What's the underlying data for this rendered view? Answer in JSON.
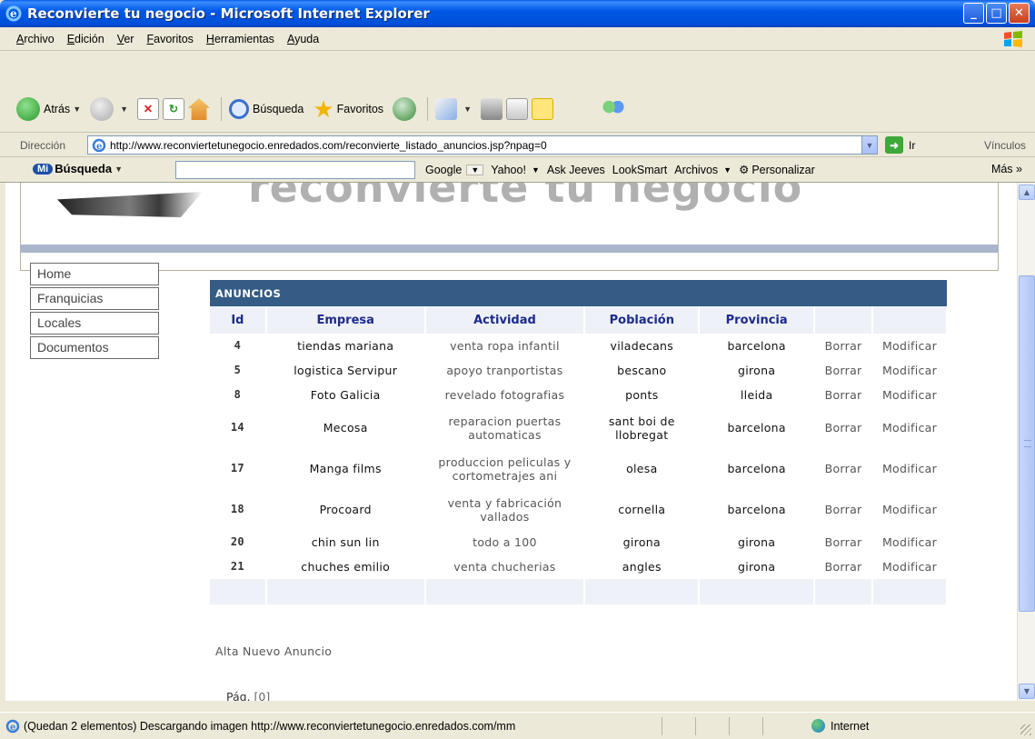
{
  "window": {
    "title": "Reconvierte tu negocio - Microsoft Internet Explorer"
  },
  "menu": [
    "Archivo",
    "Edición",
    "Ver",
    "Favoritos",
    "Herramientas",
    "Ayuda"
  ],
  "toolbar": {
    "back": "Atrás",
    "search": "Búsqueda",
    "favorites": "Favoritos"
  },
  "address": {
    "label": "Dirección",
    "url": "http://www.reconviertetunegocio.enredados.com/reconvierte_listado_anuncios.jsp?npag=0",
    "go": "Ir",
    "links": "Vínculos"
  },
  "searchbar": {
    "logo_badge": "Mi",
    "logo_text": "Búsqueda",
    "links": [
      "Google",
      "Yahoo!",
      "Ask Jeeves",
      "LookSmart",
      "Archivos"
    ],
    "customize": "Personalizar",
    "more": "Más"
  },
  "page": {
    "header_text": "reconvierte tu negocio",
    "nav": [
      "Home",
      "Franquicias",
      "Locales",
      "Documentos"
    ],
    "table_title": "ANUNCIOS",
    "columns": [
      "Id",
      "Empresa",
      "Actividad",
      "Población",
      "Provincia",
      "",
      ""
    ],
    "rows": [
      {
        "id": "4",
        "empresa": "tiendas mariana",
        "actividad": "venta ropa infantil",
        "poblacion": "viladecans",
        "provincia": "barcelona",
        "borrar": "Borrar",
        "modificar": "Modificar"
      },
      {
        "id": "5",
        "empresa": "logistica Servipur",
        "actividad": "apoyo tranportistas",
        "poblacion": "bescano",
        "provincia": "girona",
        "borrar": "Borrar",
        "modificar": "Modificar"
      },
      {
        "id": "8",
        "empresa": "Foto Galicia",
        "actividad": "revelado fotografias",
        "poblacion": "ponts",
        "provincia": "lleida",
        "borrar": "Borrar",
        "modificar": "Modificar"
      },
      {
        "id": "14",
        "empresa": "Mecosa",
        "actividad": "reparacion puertas automaticas",
        "poblacion": "sant boi de llobregat",
        "provincia": "barcelona",
        "borrar": "Borrar",
        "modificar": "Modificar"
      },
      {
        "id": "17",
        "empresa": "Manga films",
        "actividad": "produccion peliculas y cortometrajes ani",
        "poblacion": "olesa",
        "provincia": "barcelona",
        "borrar": "Borrar",
        "modificar": "Modificar"
      },
      {
        "id": "18",
        "empresa": "Procoard",
        "actividad": "venta y fabricación vallados",
        "poblacion": "cornella",
        "provincia": "barcelona",
        "borrar": "Borrar",
        "modificar": "Modificar"
      },
      {
        "id": "20",
        "empresa": "chin sun lin",
        "actividad": "todo a 100",
        "poblacion": "girona",
        "provincia": "girona",
        "borrar": "Borrar",
        "modificar": "Modificar"
      },
      {
        "id": "21",
        "empresa": "chuches emilio",
        "actividad": "venta chucherias",
        "poblacion": "angles",
        "provincia": "girona",
        "borrar": "Borrar",
        "modificar": "Modificar"
      }
    ],
    "new_link": "Alta Nuevo Anuncio",
    "pagination_label": "Pág.",
    "pagination_current": "[0]"
  },
  "status": {
    "text": "(Quedan 2 elementos) Descargando imagen http://www.reconviertetunegocio.enredados.com/mm",
    "zone": "Internet"
  },
  "colors": {
    "titlebar": "#0058e6",
    "table_header": "#355c84",
    "column_header_text": "#1d2a8a"
  }
}
